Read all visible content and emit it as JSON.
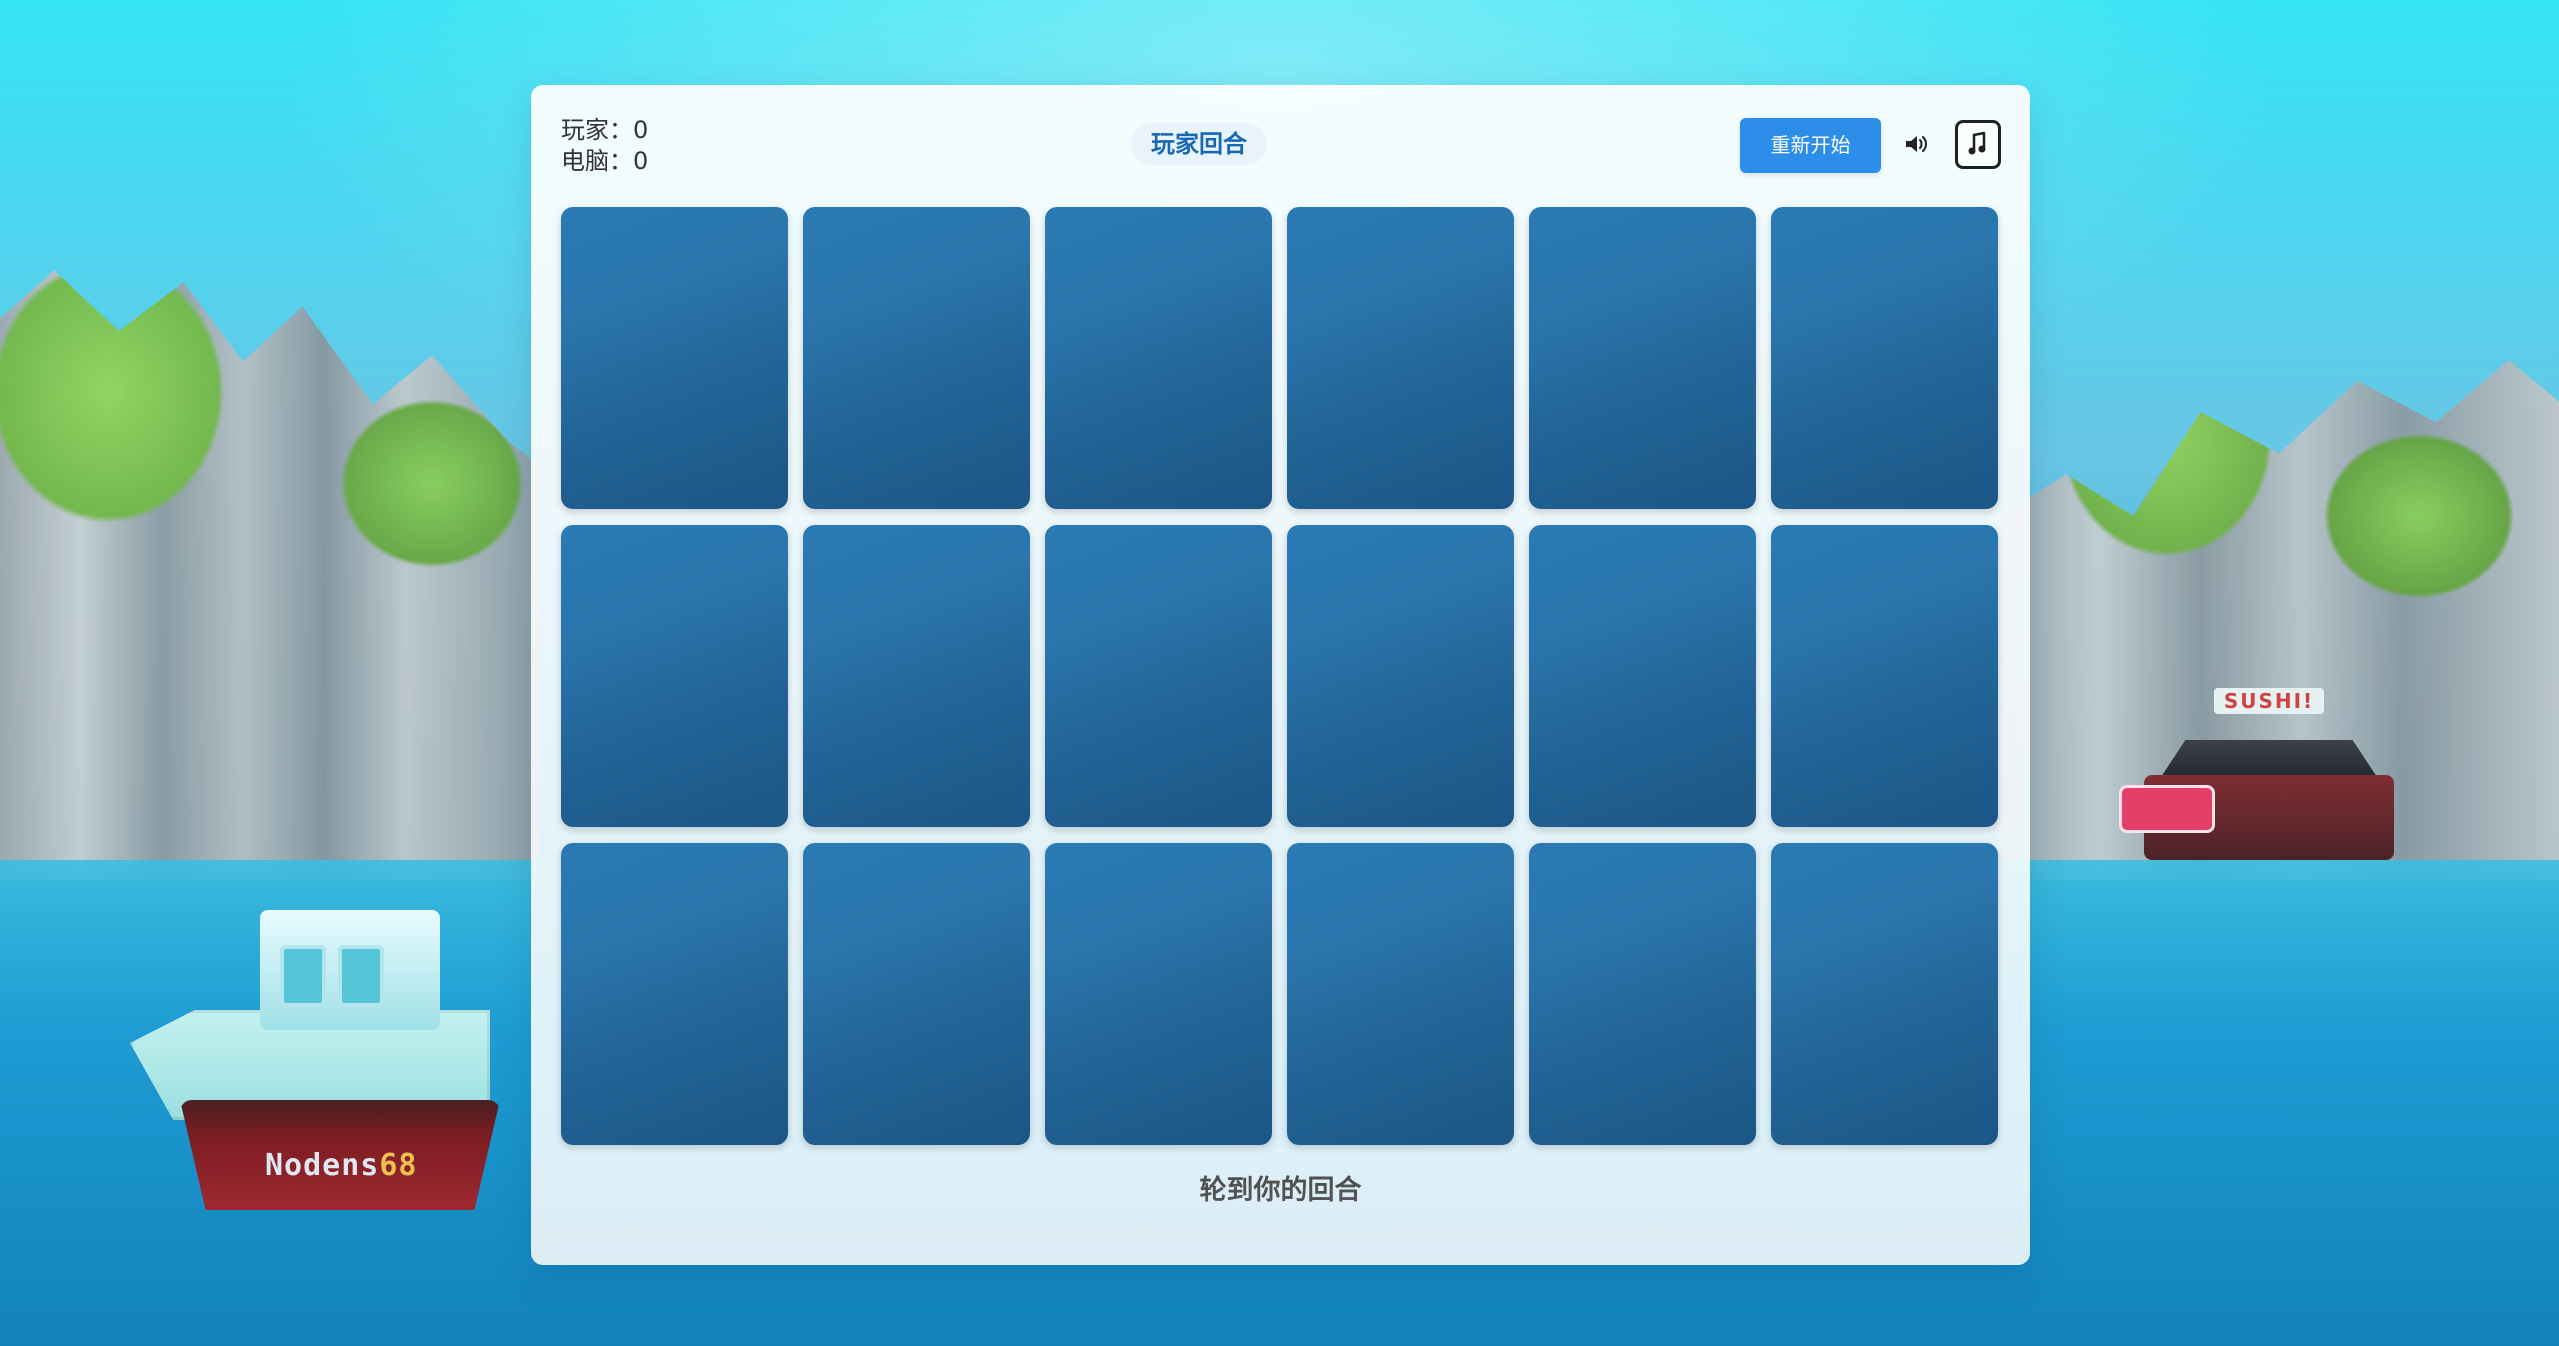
{
  "header": {
    "player_score_label": "玩家：0",
    "computer_score_label": "电脑：0",
    "turn_badge": "玩家回合",
    "restart_label": "重新开始",
    "sound_icon": "volume-icon",
    "music_icon": "music-note-icon"
  },
  "board": {
    "rows": 3,
    "columns": 6,
    "cards": [
      "",
      "",
      "",
      "",
      "",
      "",
      "",
      "",
      "",
      "",
      "",
      "",
      "",
      "",
      "",
      "",
      "",
      ""
    ]
  },
  "status": {
    "message": "轮到你的回合"
  },
  "background": {
    "boat_name": "Nodens",
    "boat_number": "68",
    "sushi_sign": "SUSHI!"
  },
  "colors": {
    "accent": "#2c8ee9",
    "turn_text": "#1768b3",
    "card_top": "#2b7ab4",
    "card_bottom": "#1b5686"
  }
}
